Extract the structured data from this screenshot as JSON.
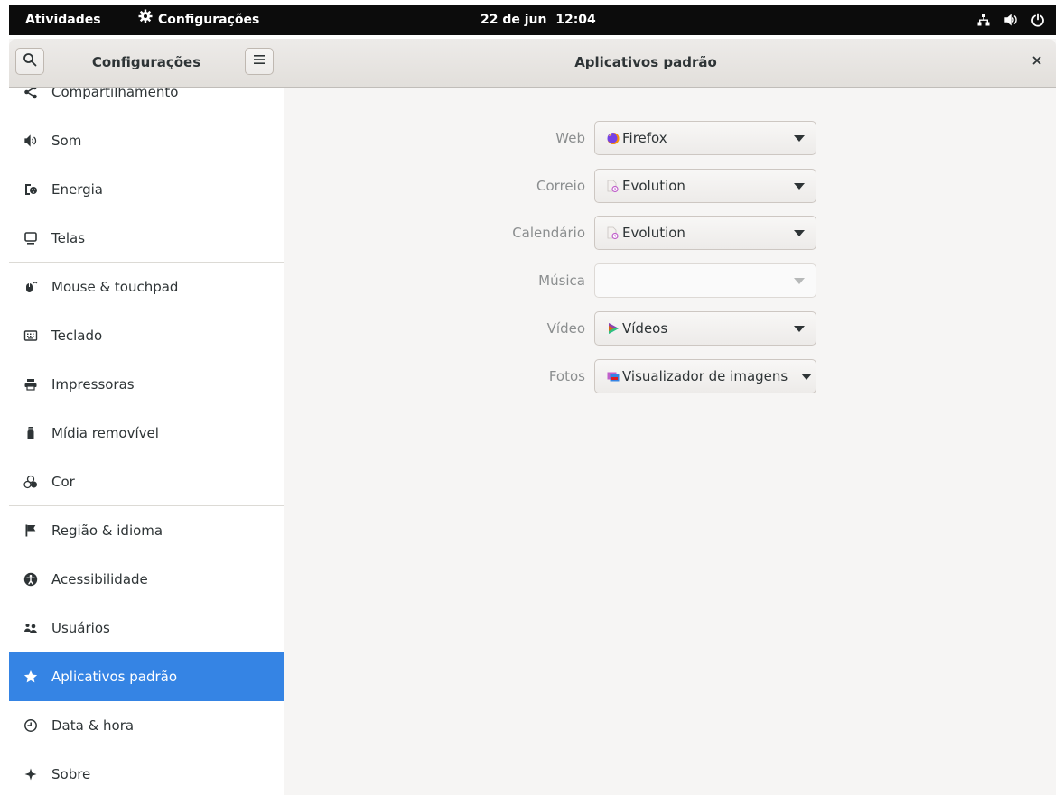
{
  "topbar": {
    "activities": "Atividades",
    "app_name": "Configurações",
    "clock": "22 de jun  12:04",
    "status_icons": [
      "network-icon",
      "volume-icon",
      "power-icon"
    ]
  },
  "headerbar": {
    "sidebar_title": "Configurações",
    "main_title": "Aplicativos padrão"
  },
  "sidebar": {
    "items": [
      {
        "label": "Compartilhamento",
        "icon": "share-icon"
      },
      {
        "label": "Som",
        "icon": "speaker-icon"
      },
      {
        "label": "Energia",
        "icon": "power-plug-icon"
      },
      {
        "label": "Telas",
        "icon": "display-icon"
      },
      {
        "label": "Mouse & touchpad",
        "icon": "mouse-icon"
      },
      {
        "label": "Teclado",
        "icon": "keyboard-icon"
      },
      {
        "label": "Impressoras",
        "icon": "printer-icon"
      },
      {
        "label": "Mídia removível",
        "icon": "usb-icon"
      },
      {
        "label": "Cor",
        "icon": "color-icon"
      },
      {
        "label": "Região & idioma",
        "icon": "flag-icon"
      },
      {
        "label": "Acessibilidade",
        "icon": "accessibility-icon"
      },
      {
        "label": "Usuários",
        "icon": "users-icon"
      },
      {
        "label": "Aplicativos padrão",
        "icon": "star-icon",
        "active": true
      },
      {
        "label": "Data & hora",
        "icon": "clock-icon"
      },
      {
        "label": "Sobre",
        "icon": "sparkle-icon"
      }
    ]
  },
  "default_apps": [
    {
      "label": "Web",
      "value": "Firefox",
      "icon": "firefox-icon"
    },
    {
      "label": "Correio",
      "value": "Evolution",
      "icon": "evolution-icon"
    },
    {
      "label": "Calendário",
      "value": "Evolution",
      "icon": "evolution-icon"
    },
    {
      "label": "Música",
      "value": "",
      "icon": ""
    },
    {
      "label": "Vídeo",
      "value": "Vídeos",
      "icon": "videos-icon"
    },
    {
      "label": "Fotos",
      "value": "Visualizador de imagens",
      "icon": "image-viewer-icon"
    }
  ],
  "colors": {
    "accent": "#3584e4",
    "topbar": "#0c0c0c",
    "window_bg": "#f6f5f4"
  }
}
